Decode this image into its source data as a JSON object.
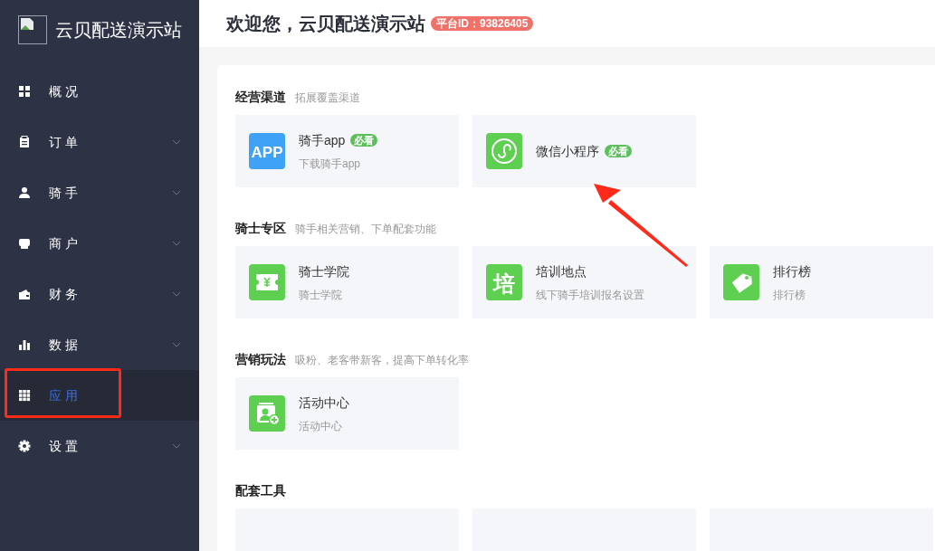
{
  "brand": {
    "name": "云贝配送演示站"
  },
  "nav": [
    {
      "label": "概况",
      "kind": "grid",
      "expandable": false,
      "selected": false
    },
    {
      "label": "订单",
      "kind": "clipboard",
      "expandable": true,
      "selected": false
    },
    {
      "label": "骑手",
      "kind": "person",
      "expandable": true,
      "selected": false
    },
    {
      "label": "商户",
      "kind": "shop",
      "expandable": true,
      "selected": false
    },
    {
      "label": "财务",
      "kind": "wallet",
      "expandable": true,
      "selected": false
    },
    {
      "label": "数据",
      "kind": "bars",
      "expandable": true,
      "selected": false
    },
    {
      "label": "应用",
      "kind": "apps",
      "expandable": false,
      "selected": true
    },
    {
      "label": "设置",
      "kind": "gear",
      "expandable": true,
      "selected": false
    }
  ],
  "header": {
    "title": "欢迎您，云贝配送演示站",
    "platform_id": "平台ID：93826405"
  },
  "sections": [
    {
      "title": "经营渠道",
      "subtitle": "拓展覆盖渠道",
      "items": [
        {
          "title": "骑手app",
          "badge": "必看",
          "desc": "下载骑手app",
          "icon": {
            "kind": "text",
            "glyph": "APP",
            "color": "#3fa2f7"
          }
        },
        {
          "title": "微信小程序",
          "badge": "必看",
          "icon": {
            "kind": "miniprogram",
            "color": "#5fcf52"
          }
        }
      ]
    },
    {
      "title": "骑士专区",
      "subtitle": "骑手相关营销、下单配套功能",
      "items": [
        {
          "title": "骑士学院",
          "desc": "骑士学院",
          "icon": {
            "kind": "ticket",
            "color": "#5fcf52"
          }
        },
        {
          "title": "培训地点",
          "desc": "线下骑手培训报名设置",
          "icon": {
            "kind": "serif",
            "glyph": "培",
            "color": "#5fcf52"
          }
        },
        {
          "title": "排行榜",
          "desc": "排行榜",
          "icon": {
            "kind": "tag",
            "color": "#5fcf52"
          }
        }
      ]
    },
    {
      "title": "营销玩法",
      "subtitle": "吸粉、老客带新客，提高下单转化率",
      "items": [
        {
          "title": "活动中心",
          "desc": "活动中心",
          "icon": {
            "kind": "activity",
            "color": "#5fcf52"
          }
        }
      ]
    },
    {
      "title": "配套工具"
    }
  ]
}
